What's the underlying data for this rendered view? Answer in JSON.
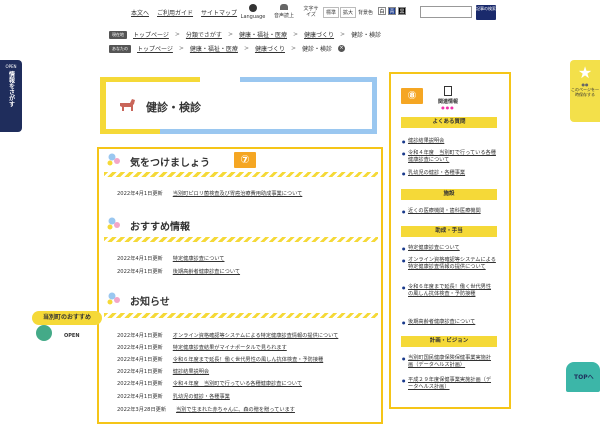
{
  "header": {
    "links": [
      "本文へ",
      "ご利用ガイド",
      "サイトマップ"
    ],
    "language_label": "Language",
    "voice_label": "音声読上",
    "font_size_label": "文字サイズ",
    "font_std": "標準",
    "font_big": "拡大",
    "color_label": "背景色",
    "color_white": "白",
    "color_blue": "青",
    "color_black": "黒",
    "search_button": "記事の検索"
  },
  "breadcrumbs": [
    {
      "tag": "現在地",
      "items": [
        "トップページ",
        "分類でさがす",
        "健康・福祉・医療",
        "健康づくり",
        "健診・検診"
      ]
    },
    {
      "tag": "あなたの",
      "items": [
        "トップページ",
        "健康・福祉・医療",
        "健康づくり",
        "健診・検診"
      ]
    }
  ],
  "left_tab": {
    "open": "OPEN",
    "text": "情報をさがす"
  },
  "right_tab": {
    "text": "このページを一時保存する"
  },
  "page_title": "健診・検診",
  "badges": {
    "main": "⑦",
    "side": "⑧"
  },
  "sections": {
    "caution": {
      "title": "気をつけましょう",
      "items": [
        {
          "date": "2022年4月1日更新",
          "text": "当別町ピロリ菌検査及び胃癌治療費用助成事業について"
        }
      ]
    },
    "recommend": {
      "title": "おすすめ情報",
      "items": [
        {
          "date": "2022年4月1日更新",
          "text": "特定健康診査について"
        },
        {
          "date": "2022年4月1日更新",
          "text": "後期高齢者健康診査について"
        }
      ]
    },
    "notice": {
      "title": "お知らせ",
      "items": [
        {
          "date": "2022年4月1日更新",
          "text": "オンライン資格確認等システムによる特定健康診査情報の提供について"
        },
        {
          "date": "2022年4月1日更新",
          "text": "特定健康診査結果がマイナポータルで見られます"
        },
        {
          "date": "2022年4月1日更新",
          "text": "令和６年度まで延長！働く世代男性の風しん抗体検査・予防接種"
        },
        {
          "date": "2022年4月1日更新",
          "text": "健診結果説明会"
        },
        {
          "date": "2022年4月1日更新",
          "text": "令和４年度　当別町で行っている各種健康診査について"
        },
        {
          "date": "2022年4月1日更新",
          "text": "乳幼児の健診・各種事業"
        },
        {
          "date": "2022年3月28日更新",
          "text": "当別で生まれた赤ちゃんに、森の贈を贈っています"
        }
      ]
    }
  },
  "sidebar": {
    "heading": "関連情報",
    "groups": [
      {
        "title": "よくある質問",
        "items": [
          "健診結果説明会",
          "令和４年度　当別町で行っている各種健康診査について",
          "乳幼児の健診・各種事業"
        ]
      },
      {
        "title": "施設",
        "items": [
          "近くの医療機関・歯科医療機関"
        ]
      },
      {
        "title": "助成・手当",
        "items": [
          "特定健康診査について",
          "オンライン資格確認等システムによる特定健康診査情報の提供について",
          "令和６年度まで延長！働く世代男性の風しん抗体検査・予防接種",
          "後期高齢者健康診査について"
        ]
      },
      {
        "title": "計画・ビジョン",
        "items": [
          "当別町国民健康保険保健事業実施計画（データヘルス計画）",
          "平成２９年度保健事業実施計画（データヘルス計画）"
        ]
      }
    ]
  },
  "recommend_float": {
    "label": "当別町のおすすめ",
    "open": "OPEN"
  },
  "top_button": {
    "label": "TOPへ"
  }
}
